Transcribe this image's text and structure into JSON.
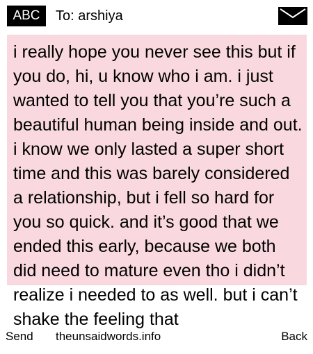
{
  "header": {
    "input_mode": "ABC",
    "recipient": "To: arshiya",
    "envelope_icon": "envelope-icon"
  },
  "message": {
    "text": "i really hope you never see this but if you do, hi, u know who i am. i just wanted to tell you that you’re such a beautiful human being inside and out. i know we only lasted a super short time and this was barely considered a relationship, but i fell so hard for you so quick. and it’s good that we ended this early, because we both did need to mature even tho i didn’t realize i needed to as well. but i can’t shake the feeling that",
    "bubble_color": "#f9d9df"
  },
  "footer": {
    "left_key": "Send",
    "center_text": "theunsaidwords.info",
    "right_key": "Back"
  }
}
